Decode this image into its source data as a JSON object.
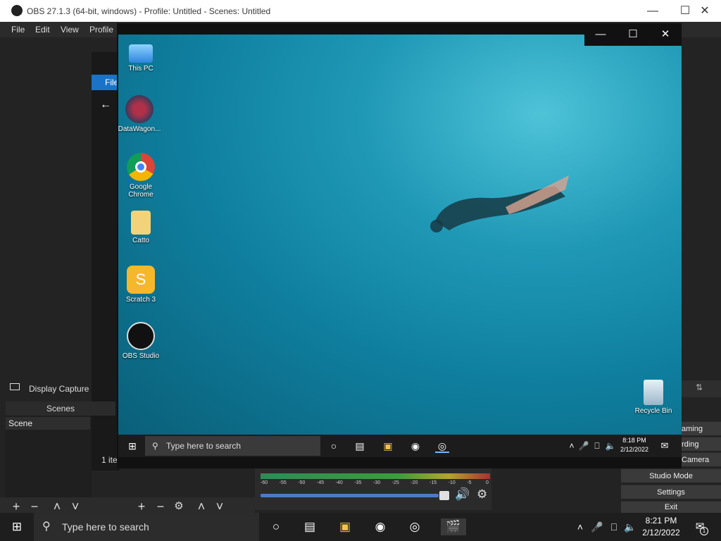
{
  "obs": {
    "title": "OBS 27.1.3 (64-bit, windows) - Profile: Untitled - Scenes: Untitled",
    "menu": [
      "File",
      "Edit",
      "View",
      "Profile"
    ],
    "source_label": "Display Capture",
    "scenes_header": "Scenes",
    "scene_item": "Scene",
    "items_count": "1 ite",
    "controls": [
      "aming",
      "rding",
      "Camera",
      "Studio Mode",
      "Settings",
      "Exit"
    ],
    "meter_ticks": [
      "-60",
      "-55",
      "-50",
      "-45",
      "-40",
      "-35",
      "-30",
      "-25",
      "-20",
      "-15",
      "-10",
      "-5",
      "0"
    ],
    "volume_level": 0.95
  },
  "explorer": {
    "file_tab": "File"
  },
  "remote": {
    "icons": [
      {
        "label": "This PC",
        "icon": "monitor-icon"
      },
      {
        "label": "DataWagon...",
        "icon": "datawagon-icon"
      },
      {
        "label": "Google Chrome",
        "icon": "chrome-icon"
      },
      {
        "label": "Catto",
        "icon": "folder-icon"
      },
      {
        "label": "Scratch 3",
        "icon": "scratch-icon"
      },
      {
        "label": "OBS Studio",
        "icon": "obs-icon"
      }
    ],
    "recycle_bin": "Recycle Bin",
    "search_placeholder": "Type here to search",
    "time": "8:18 PM",
    "date": "2/12/2022"
  },
  "taskbar": {
    "search_placeholder": "Type here to search",
    "time": "8:21 PM",
    "date": "2/12/2022",
    "notification_count": "1"
  }
}
